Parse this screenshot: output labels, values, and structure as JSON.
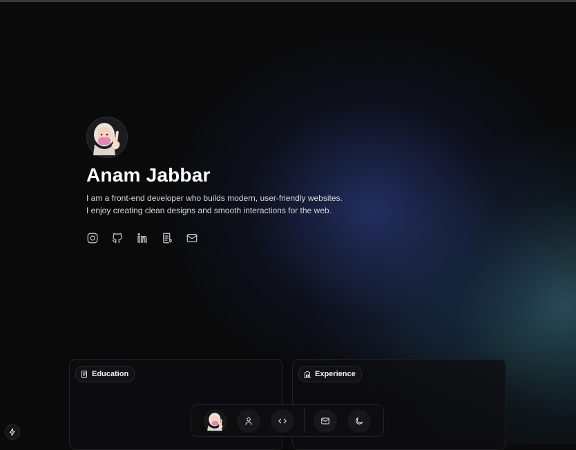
{
  "profile": {
    "name": "Anam Jabbar",
    "bio_line1": "I am a front-end developer who builds modern, user-friendly websites.",
    "bio_line2": "I enjoy creating clean designs and smooth interactions for the web.",
    "avatar_icon": "memoji-avatar-icon"
  },
  "socials": [
    {
      "icon": "instagram-icon"
    },
    {
      "icon": "github-icon"
    },
    {
      "icon": "linkedin-icon"
    },
    {
      "icon": "resume-icon"
    },
    {
      "icon": "mail-icon"
    }
  ],
  "cards": {
    "education": {
      "label": "Education",
      "icon": "book-icon"
    },
    "experience": {
      "label": "Experience",
      "icon": "building-icon"
    }
  },
  "dock": {
    "items": [
      {
        "icon": "avatar-icon"
      },
      {
        "icon": "user-icon"
      },
      {
        "icon": "code-icon"
      },
      {
        "icon": "mail-icon"
      },
      {
        "icon": "moon-icon"
      }
    ]
  },
  "colors": {
    "background": "#0a0a0b",
    "glow_blue": "#26346e",
    "glow_teal": "#325f6e",
    "text_primary": "#ffffff",
    "text_secondary": "#d8d8dc"
  }
}
